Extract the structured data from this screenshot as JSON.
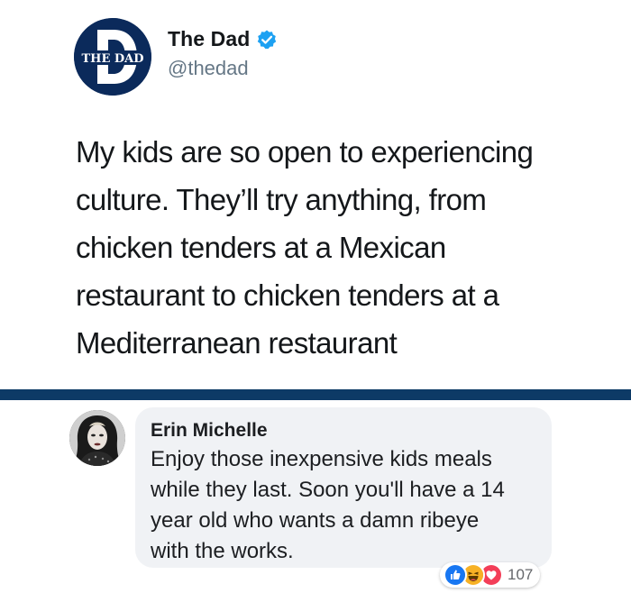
{
  "tweet": {
    "avatar_logo": "THE DAD",
    "display_name": "The Dad",
    "verified": true,
    "handle": "@thedad",
    "text_lines": [
      "My kids are so open to experiencing",
      "culture. They’ll try anything, from",
      "chicken tenders at a Mexican",
      "restaurant to chicken tenders at a",
      "Mediterranean restaurant"
    ]
  },
  "comment": {
    "author": "Erin Michelle",
    "text_lines": [
      "Enjoy those inexpensive kids meals",
      "while they last. Soon you'll have a 14",
      "year old who wants a damn ribeye",
      "with the works."
    ],
    "reactions": {
      "icons": [
        "like-icon",
        "haha-icon",
        "love-icon"
      ],
      "count": "107"
    }
  },
  "colors": {
    "divider": "#0d3a66",
    "avatar_bg": "#0b2a5b",
    "verified": "#1da1f2",
    "like": "#1877f2",
    "haha": "#f7b125",
    "love": "#f33e58",
    "bubble": "#f0f2f5"
  }
}
